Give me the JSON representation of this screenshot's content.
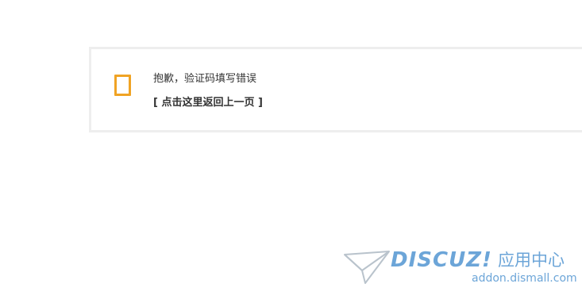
{
  "message": {
    "text": "抱歉，验证码填写错误",
    "back_link": "[ 点击这里返回上一页 ]",
    "icon": "alert-icon",
    "icon_color": "#f0a324"
  },
  "watermark": {
    "brand": "DISCUZ!",
    "brand_suffix": "应用中心",
    "domain": "addon.dismall.com",
    "color": "#5d9cd4"
  }
}
